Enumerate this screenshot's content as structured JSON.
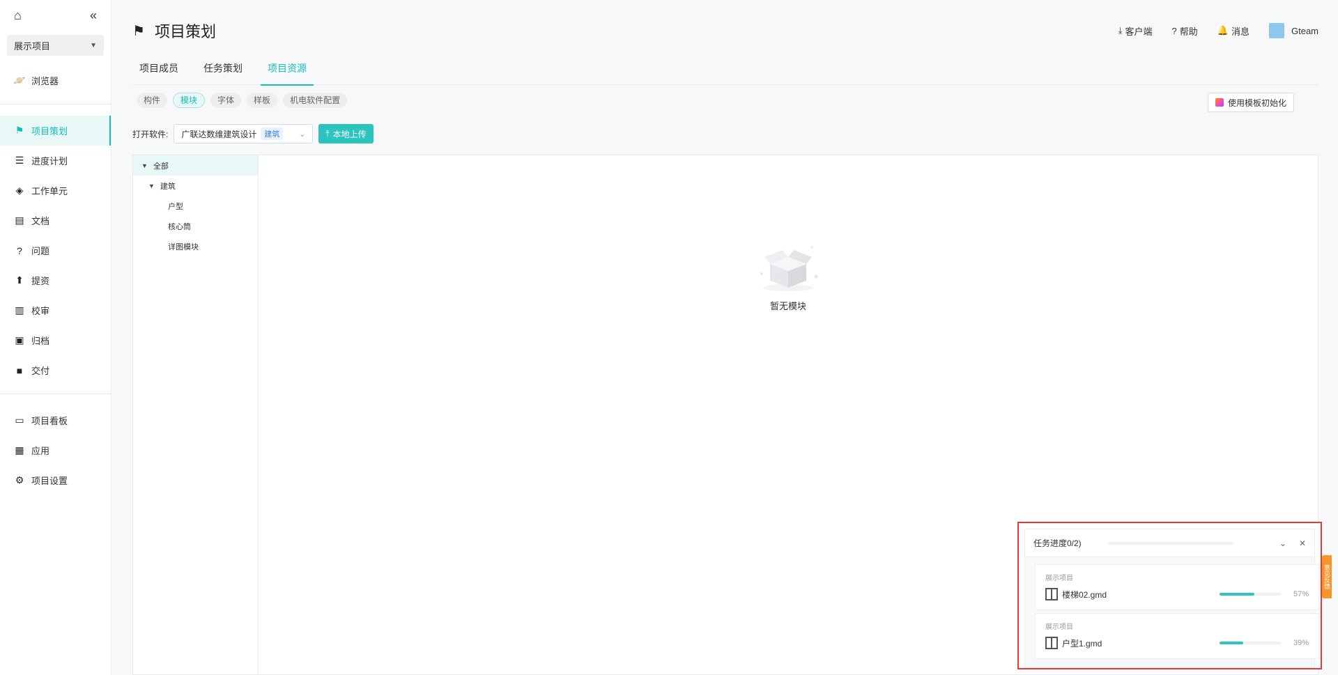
{
  "sidebar": {
    "project": "展示项目",
    "items_top": [
      {
        "label": "浏览器",
        "icon": "planet-icon"
      }
    ],
    "items_main": [
      {
        "label": "项目策划",
        "icon": "flag-icon",
        "active": true
      },
      {
        "label": "进度计划",
        "icon": "gantt-icon"
      },
      {
        "label": "工作单元",
        "icon": "cube-icon"
      },
      {
        "label": "文档",
        "icon": "document-icon"
      },
      {
        "label": "问题",
        "icon": "question-icon"
      },
      {
        "label": "提资",
        "icon": "submit-icon"
      },
      {
        "label": "校审",
        "icon": "review-icon"
      },
      {
        "label": "归档",
        "icon": "archive-icon"
      },
      {
        "label": "交付",
        "icon": "briefcase-icon"
      }
    ],
    "items_bottom": [
      {
        "label": "项目看板",
        "icon": "board-icon"
      },
      {
        "label": "应用",
        "icon": "apps-icon"
      },
      {
        "label": "项目设置",
        "icon": "gear-icon"
      }
    ]
  },
  "header": {
    "title": "项目策划",
    "actions": {
      "client": "客户端",
      "help": "帮助",
      "messages": "消息",
      "user": "Gteam"
    }
  },
  "tabs": [
    {
      "label": "项目成员"
    },
    {
      "label": "任务策划"
    },
    {
      "label": "项目资源",
      "active": true
    }
  ],
  "chips": [
    {
      "label": "构件"
    },
    {
      "label": "模块",
      "active": true
    },
    {
      "label": "字体"
    },
    {
      "label": "样板"
    },
    {
      "label": "机电软件配置"
    }
  ],
  "template_button": "使用模板初始化",
  "open_software": {
    "label": "打开软件:",
    "selected": "广联达数维建筑设计",
    "tag": "建筑",
    "upload": "本地上传"
  },
  "tree": [
    {
      "label": "全部",
      "level": 0,
      "expanded": true,
      "selected": true
    },
    {
      "label": "建筑",
      "level": 1,
      "expanded": true
    },
    {
      "label": "户型",
      "level": 2
    },
    {
      "label": "核心筒",
      "level": 2
    },
    {
      "label": "详图模块",
      "level": 2
    }
  ],
  "empty_text": "暂无模块",
  "progress_popup": {
    "title": "任务进度0/2)",
    "tasks": [
      {
        "project": "展示项目",
        "file": "楼梯02.gmd",
        "progress": 57,
        "percent_text": "57%"
      },
      {
        "project": "展示项目",
        "file": "户型1.gmd",
        "progress": 39,
        "percent_text": "39%"
      }
    ]
  },
  "floating_tab": "意见反馈",
  "colors": {
    "accent": "#16bdb8",
    "highlight_border": "#e53935",
    "float_tab": "#f7942a"
  }
}
